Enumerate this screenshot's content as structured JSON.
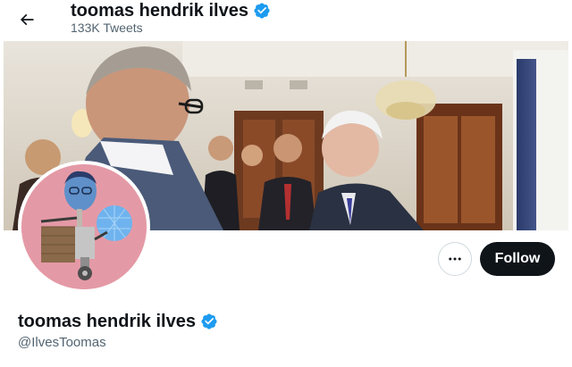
{
  "header": {
    "back_icon": "arrow-left-icon",
    "title": "toomas hendrik ilves",
    "tweet_count": "133K Tweets",
    "verified_icon": "verified-badge-icon"
  },
  "profile": {
    "display_name": "toomas hendrik ilves",
    "handle": "@IlvesToomas",
    "verified_icon": "verified-badge-icon"
  },
  "actions": {
    "more_icon": "more-horizontal-icon",
    "follow_label": "Follow"
  },
  "colors": {
    "verified_blue": "#1d9bf0",
    "follow_bg": "#0f1419",
    "secondary_text": "#536471",
    "avatar_bg": "#e49aa6"
  }
}
